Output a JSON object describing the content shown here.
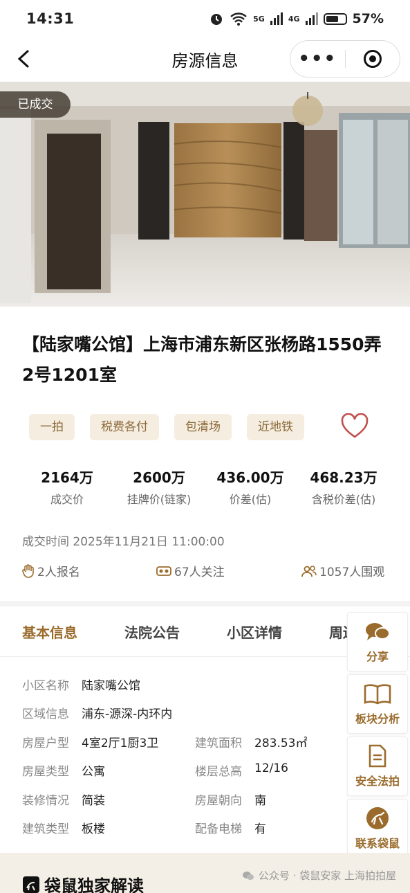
{
  "status_bar": {
    "time": "14:31",
    "signal_labels": [
      "5G",
      "4G"
    ],
    "battery": "57%"
  },
  "nav": {
    "back_icon": "chevron-left-icon",
    "title": "房源信息",
    "more_icon": "more-dots-icon",
    "close_icon": "target-circle-icon"
  },
  "hero": {
    "badge": "已成交"
  },
  "property": {
    "title": "【陆家嘴公馆】上海市浦东新区张杨路1550弄2号1201室",
    "tags": [
      "一拍",
      "税费各付",
      "包清场",
      "近地铁"
    ],
    "favorite_icon": "heart-icon"
  },
  "stats": [
    {
      "value": "2164万",
      "label": "成交价"
    },
    {
      "value": "2600万",
      "label": "挂牌价(链家)"
    },
    {
      "value": "436.00万",
      "label": "价差(估)"
    },
    {
      "value": "468.23万",
      "label": "含税价差(估)"
    }
  ],
  "deal_time": {
    "label": "成交时间",
    "value": "2025年11月21日 11:00:00"
  },
  "counts": {
    "signup": "2人报名",
    "follow": "67人关注",
    "watch": "1057人围观"
  },
  "tabs": [
    "基本信息",
    "法院公告",
    "小区详情",
    "周边"
  ],
  "info": {
    "community": {
      "label": "小区名称",
      "value": "陆家嘴公馆"
    },
    "area": {
      "label": "区域信息",
      "value": "浦东-源深-内环内"
    },
    "layout": {
      "label": "房屋户型",
      "value": "4室2厅1厨3卫"
    },
    "size": {
      "label": "建筑面积",
      "value": "283.53㎡"
    },
    "type": {
      "label": "房屋类型",
      "value": "公寓"
    },
    "floor": {
      "label": "楼层总高",
      "value": "12/16"
    },
    "decor": {
      "label": "装修情况",
      "value": "简装"
    },
    "orient": {
      "label": "房屋朝向",
      "value": "南"
    },
    "build": {
      "label": "建筑类型",
      "value": "板楼"
    },
    "elevator": {
      "label": "配备电梯",
      "value": "有"
    }
  },
  "float_buttons": [
    {
      "label": "分享",
      "icon": "chat-bubbles-icon"
    },
    {
      "label": "板块分析",
      "icon": "open-book-icon"
    },
    {
      "label": "安全法拍",
      "icon": "document-icon"
    },
    {
      "label": "联系袋鼠",
      "icon": "kangaroo-logo-icon"
    }
  ],
  "bottom": {
    "heading": "袋鼠独家解读",
    "watermark": "公众号 · 袋鼠安家 上海拍拍屋"
  },
  "colors": {
    "accent": "#9a6b2c",
    "tag_bg": "#f5ede0",
    "heart": "#c0504d"
  }
}
